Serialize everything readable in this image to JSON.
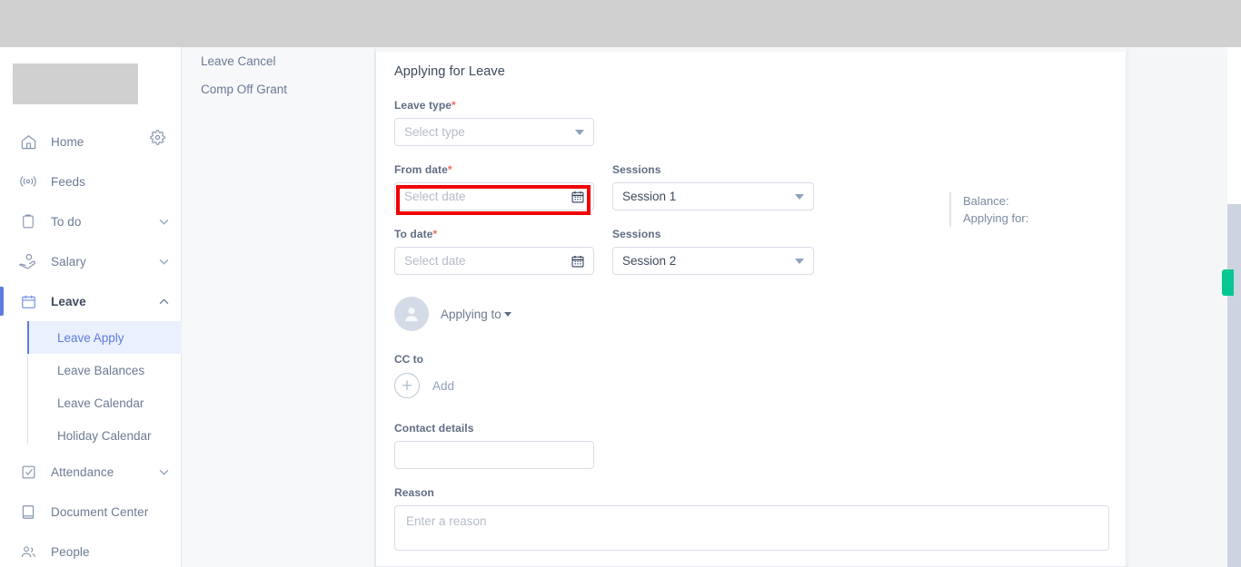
{
  "sidebar": {
    "logo_alt": "company-logo",
    "gear_icon": "gear-icon",
    "items": [
      {
        "label": "Home",
        "icon": "home-icon",
        "expandable": false,
        "active": false
      },
      {
        "label": "Feeds",
        "icon": "feeds-broadcast-icon",
        "expandable": false,
        "active": false
      },
      {
        "label": "To do",
        "icon": "clipboard-icon",
        "expandable": true,
        "active": false
      },
      {
        "label": "Salary",
        "icon": "salary-hand-icon",
        "expandable": true,
        "active": false
      },
      {
        "label": "Leave",
        "icon": "calendar-icon",
        "expandable": true,
        "active": true
      },
      {
        "label": "Attendance",
        "icon": "check-square-icon",
        "expandable": true,
        "active": false
      },
      {
        "label": "Document Center",
        "icon": "book-icon",
        "expandable": false,
        "active": false
      },
      {
        "label": "People",
        "icon": "people-icon",
        "expandable": false,
        "active": false
      }
    ],
    "leave_children": [
      {
        "label": "Leave Apply",
        "selected": true
      },
      {
        "label": "Leave Balances",
        "selected": false
      },
      {
        "label": "Leave Calendar",
        "selected": false
      },
      {
        "label": "Holiday Calendar",
        "selected": false
      }
    ]
  },
  "secondary_panel": {
    "items": [
      {
        "label": "Leave Cancel"
      },
      {
        "label": "Comp Off Grant"
      }
    ]
  },
  "form": {
    "title": "Applying for Leave",
    "leave_type": {
      "label": "Leave type",
      "required": "*",
      "placeholder": "Select type",
      "value": ""
    },
    "from_date": {
      "label": "From date",
      "required": "*",
      "placeholder": "Select date",
      "value": "",
      "icon": "calendar-icon",
      "highlighted": true
    },
    "from_sessions": {
      "label": "Sessions",
      "value": "Session 1"
    },
    "to_date": {
      "label": "To date",
      "required": "*",
      "placeholder": "Select date",
      "value": "",
      "icon": "calendar-icon"
    },
    "to_sessions": {
      "label": "Sessions",
      "value": "Session 2"
    },
    "applying_to": {
      "label": "Applying to",
      "avatar_icon": "user-avatar-icon",
      "caret_icon": "caret-down-icon"
    },
    "cc_to": {
      "label": "CC to",
      "add_label": "Add",
      "add_icon": "plus-circle-icon"
    },
    "contact_details": {
      "label": "Contact details",
      "placeholder": "",
      "value": ""
    },
    "reason": {
      "label": "Reason",
      "placeholder": "Enter a reason",
      "value": ""
    }
  },
  "balance_panel": {
    "balance_label": "Balance:",
    "applying_for_label": "Applying for:"
  },
  "widgets": {
    "side_tab": "green-side-tab"
  },
  "colors": {
    "accent_blue": "#5b7cde",
    "highlight_red": "#f20000",
    "green_tab": "#06c792",
    "required_star": "#f4685f",
    "topbar_grey": "#d0d0d0"
  }
}
